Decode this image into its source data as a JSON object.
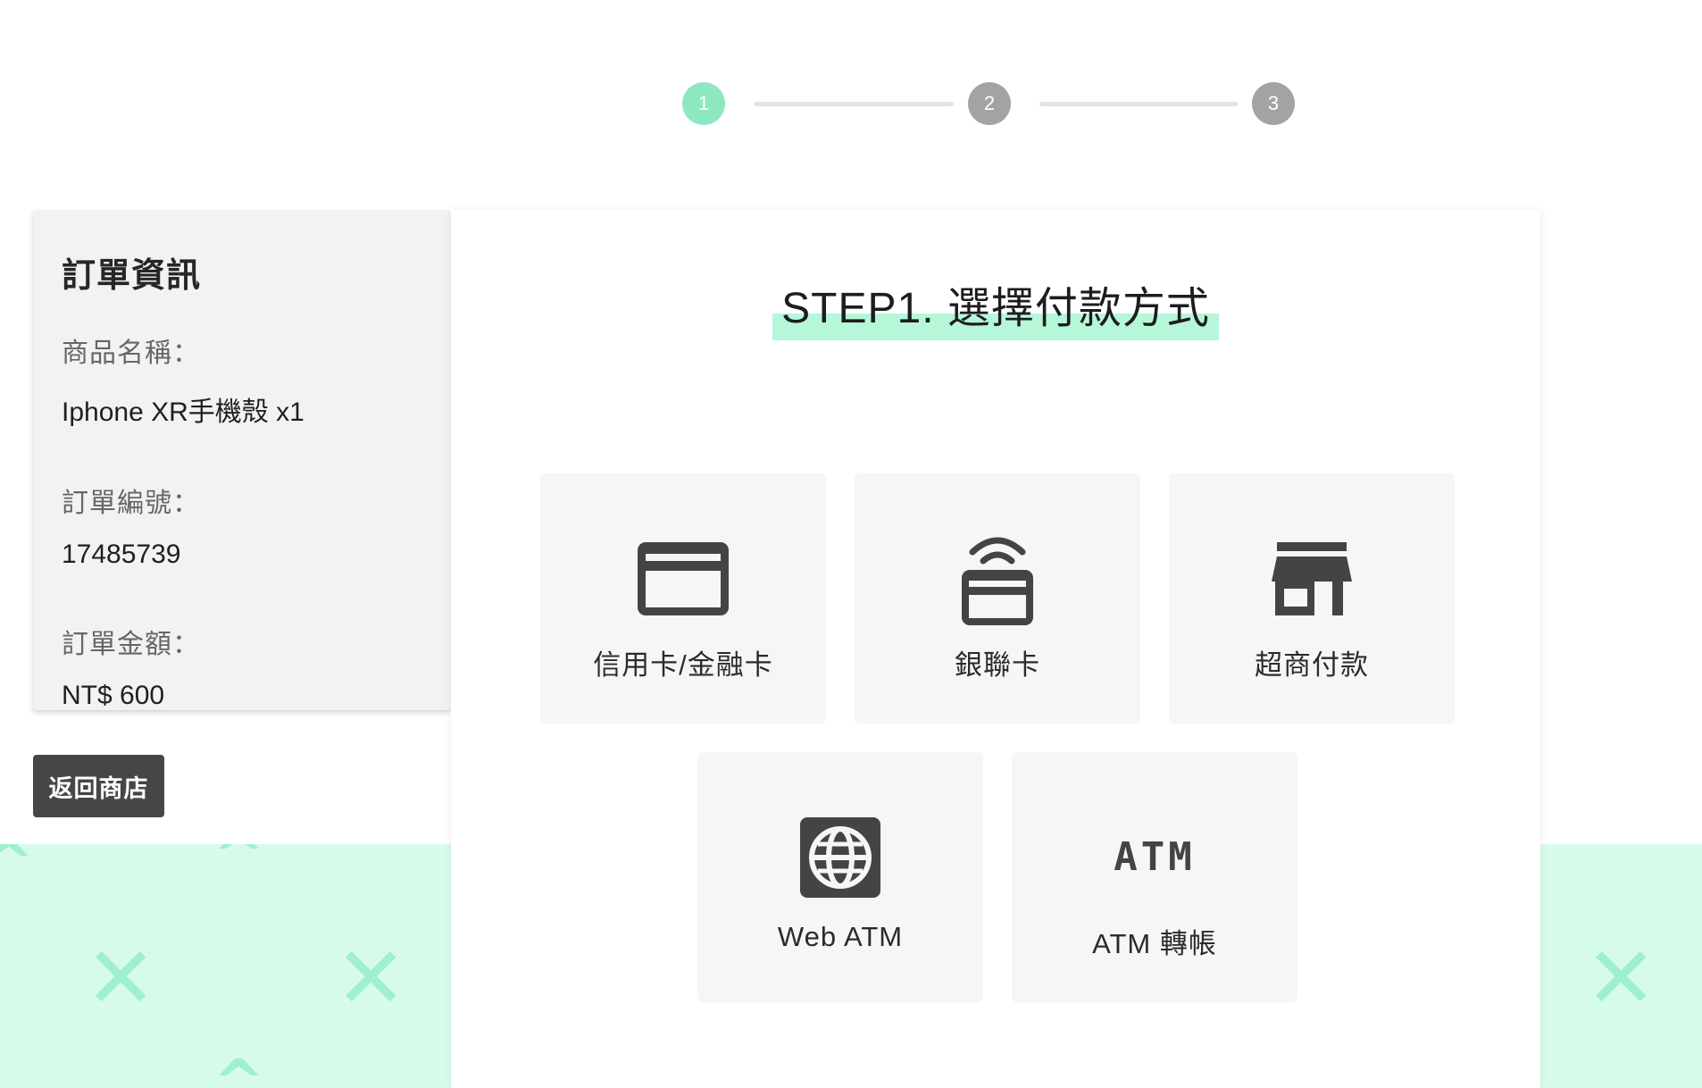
{
  "stepper": {
    "steps": [
      "1",
      "2",
      "3"
    ],
    "active_step": 1
  },
  "order": {
    "title": "訂單資訊",
    "product_label": "商品名稱：",
    "product_value": "Iphone XR手機殼 x1",
    "number_label": "訂單編號：",
    "number_value": "17485739",
    "amount_label": "訂單金額：",
    "amount_value": "NT$ 600"
  },
  "back_button": "返回商店",
  "main": {
    "title": "STEP1. 選擇付款方式",
    "methods": [
      {
        "label": "信用卡/金融卡",
        "icon": "credit-card-icon"
      },
      {
        "label": "銀聯卡",
        "icon": "unionpay-contactless-card-icon"
      },
      {
        "label": "超商付款",
        "icon": "storefront-icon"
      },
      {
        "label": "Web ATM",
        "icon": "globe-icon"
      },
      {
        "label": "ATM 轉帳",
        "icon": "atm-text-icon",
        "icon_text": "ATM"
      }
    ]
  },
  "colors": {
    "accent_mint": "#8de8c2",
    "highlight_mint": "#b6f7da",
    "background_band": "#d7fbeb",
    "inactive_step": "#a3a3a3",
    "button_dark": "#464646"
  }
}
